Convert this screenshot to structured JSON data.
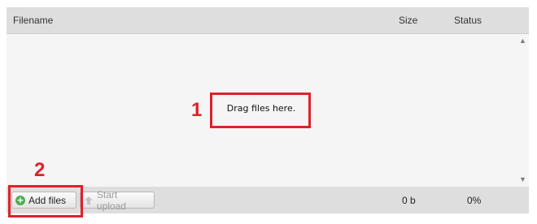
{
  "header": {
    "filename_label": "Filename",
    "size_label": "Size",
    "status_label": "Status"
  },
  "drop_area": {
    "text": "Drag files here."
  },
  "footer": {
    "add_files_label": "Add files",
    "start_upload_label": "Start upload",
    "total_size": "0 b",
    "total_status": "0%"
  },
  "annotations": [
    {
      "number": "1",
      "target": "drop area text"
    },
    {
      "number": "2",
      "target": "add files button"
    }
  ],
  "icons": {
    "add": "plus-circle-icon",
    "upload": "upload-arrow-icon",
    "scroll_up": "scroll-up-icon",
    "scroll_down": "scroll-down-icon"
  },
  "colors": {
    "annotation": "#e0202a",
    "add_icon": "#4caf50"
  }
}
